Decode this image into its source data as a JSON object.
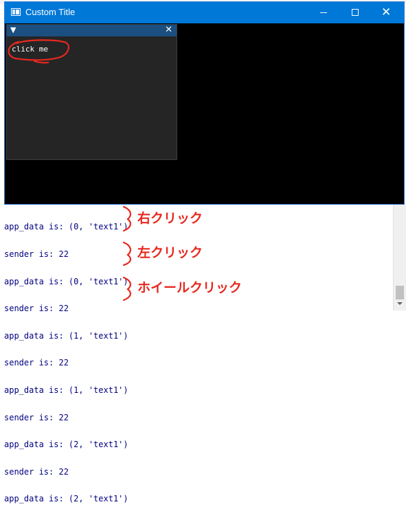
{
  "window": {
    "title": "Custom Title"
  },
  "inner_window": {
    "collapse_glyph": "▼",
    "close_glyph": "✕",
    "button_label": "click me"
  },
  "console": {
    "lines": [
      "app_data is: (0, 'text1')",
      "sender is: 22",
      "app_data is: (0, 'text1')",
      "sender is: 22",
      "app_data is: (1, 'text1')",
      "sender is: 22",
      "app_data is: (1, 'text1')",
      "sender is: 22",
      "app_data is: (2, 'text1')",
      "sender is: 22",
      "app_data is: (2, 'text1')"
    ]
  },
  "annotations": {
    "right_click": "右クリック",
    "left_click": "左クリック",
    "wheel_click": "ホイールクリック",
    "color": "#e8281e"
  },
  "colors": {
    "titlebar": "#0078d7",
    "inner_title": "#1b4f7f",
    "console_text": "#000080"
  }
}
